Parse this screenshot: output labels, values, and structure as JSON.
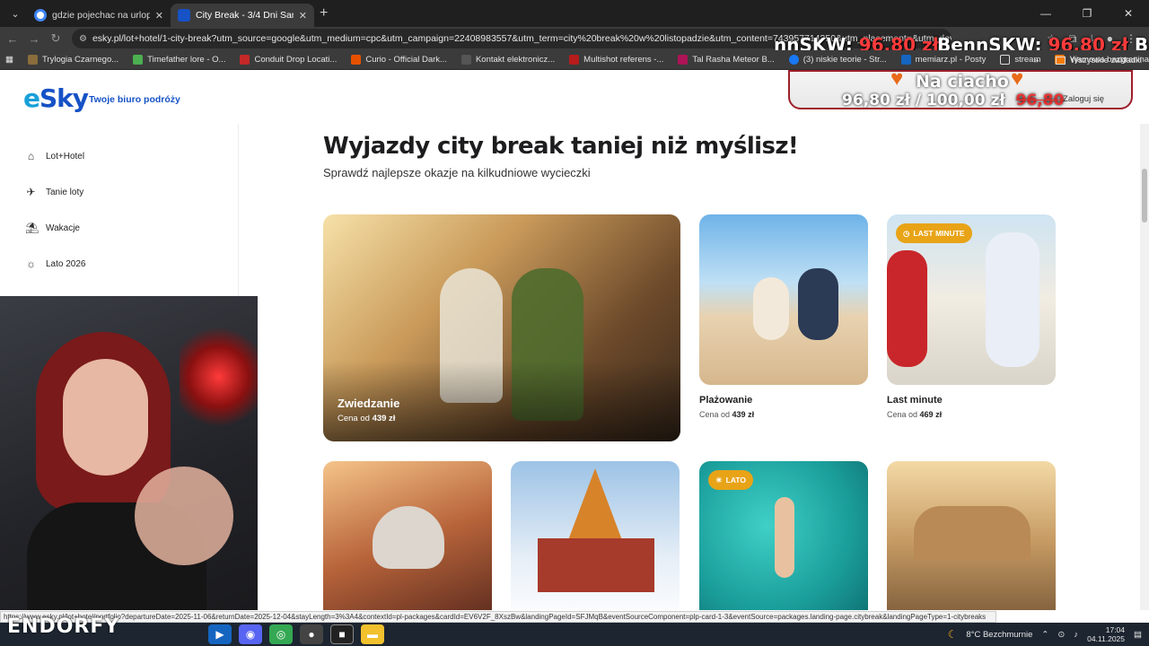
{
  "browser": {
    "tabs": [
      {
        "title": "gdzie pojechac na urlop w listo",
        "active": false
      },
      {
        "title": "City Break - 3/4 Dni Samolotem",
        "active": true
      }
    ],
    "new_tab": "+",
    "url": "esky.pl/lot+hotel/1-city-break?utm_source=google&utm_medium=cpc&utm_campaign=22408983557&utm_term=city%20break%20w%20listopadzie&utm_content=743957714350&utm_placement=&utm_device=c&gclid=Cj0KCQ",
    "bookmarks": [
      "Trylogia Czarnego...",
      "Timefather lore - O...",
      "Conduit Drop Locati...",
      "Curio - Official Dark...",
      "Kontakt elektronicz...",
      "Multishot referens -...",
      "Tal Rasha Meteor B...",
      "(3) niskie teorie - Str...",
      "memiarz.pl - Posty",
      "stream",
      "Yjamowa bazgranina"
    ],
    "bookmarks_more": "»",
    "bookmarks_all": "Wszystkie zakładki"
  },
  "stream_overlay": {
    "ticker_left": "nnSKW:",
    "ticker_left_price": "96,80 zł",
    "ticker_right": "BennSKW:",
    "ticker_right_price": "96,80 zł",
    "ticker_cut": "Be",
    "promo_title": "Na ciacho",
    "promo_price": "96,80 zł",
    "promo_sep": "/",
    "promo_goal": "100,00 zł",
    "promo_struck": "96,80",
    "brand": "ENDORFY"
  },
  "site": {
    "logo": "eSky",
    "tagline": "Twoje biuro podróży",
    "login": "Zaloguj się",
    "nav": [
      {
        "label": "Lot+Hotel",
        "icon": "hotel-icon"
      },
      {
        "label": "Tanie loty",
        "icon": "plane-icon"
      },
      {
        "label": "Wakacje",
        "icon": "beach-icon"
      },
      {
        "label": "Lato 2026",
        "icon": "sun-icon"
      }
    ],
    "hero_title": "Wyjazdy city break taniej niż myślisz!",
    "hero_subtitle": "Sprawdź najlepsze okazje na kilkudniowe wycieczki",
    "cards": [
      {
        "title": "Zwiedzanie",
        "price_prefix": "Cena od",
        "price": "439 zł"
      },
      {
        "title": "Plażowanie",
        "price_prefix": "Cena od",
        "price": "439 zł"
      },
      {
        "title": "Last minute",
        "price_prefix": "Cena od",
        "price": "469 zł",
        "badge": "LAST MINUTE"
      }
    ],
    "row2_badge": "LATO"
  },
  "status_url": "https://www.esky.pl/lot+hotel/portfolio?departureDate=2025-11-06&returnDate=2025-12-04&stayLength=3%3A4&contextId=pl-packages&cardId=EV6V2F_8XszBw&landingPageId=SFJMqB&eventSourceComponent=plp-card-1-3&eventSource=packages.landing-page.citybreak&landingPageType=1-citybreaks",
  "taskbar": {
    "weather": "8°C Bezchmurnie",
    "time": "17:04",
    "date": "04.11.2025"
  },
  "colors": {
    "esky_blue": "#1652c6",
    "badge_orange": "#e8a317",
    "overlay_red": "#ff3b3b"
  }
}
